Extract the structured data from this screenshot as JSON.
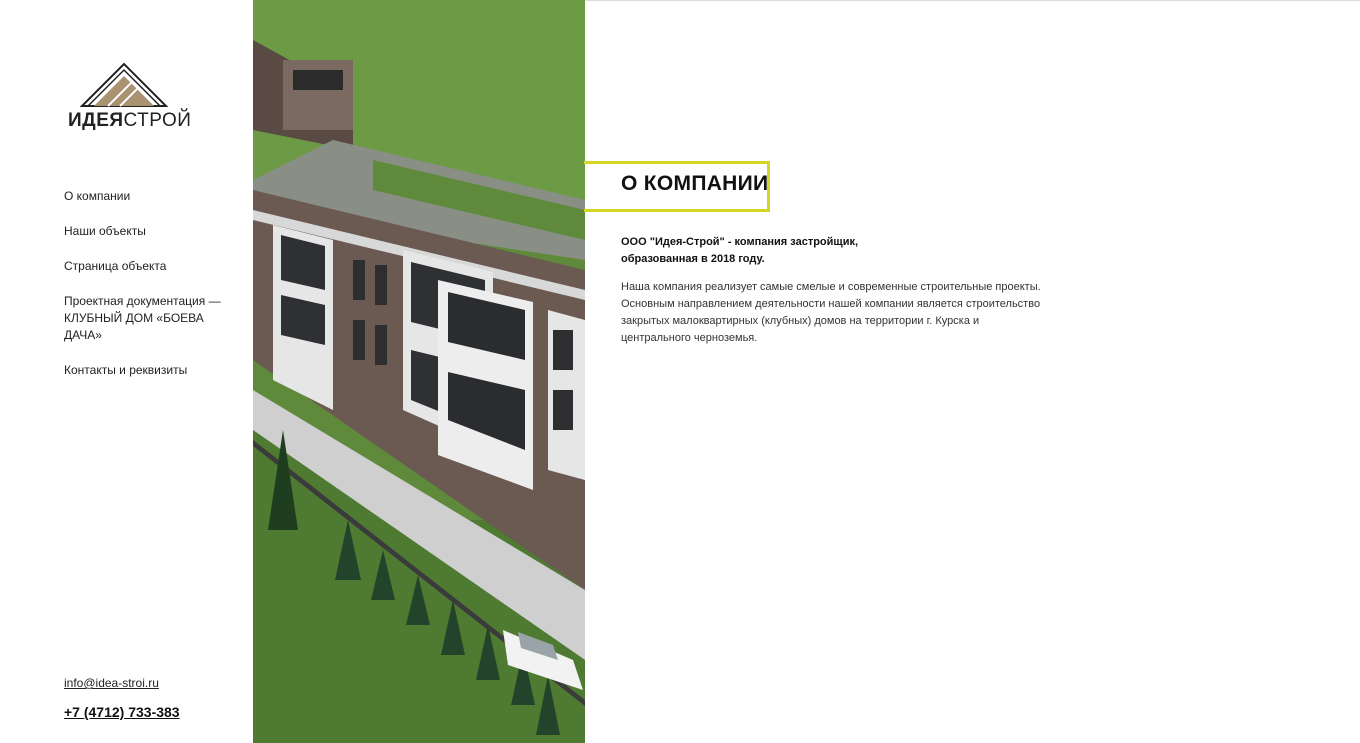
{
  "brand": {
    "name_bold": "ИДЕЯ",
    "name_regular": "СТРОЙ"
  },
  "nav": {
    "items": [
      {
        "label": "О компании"
      },
      {
        "label": "Наши объекты"
      },
      {
        "label": "Страница объекта"
      },
      {
        "label": "Проектная документация — КЛУБНЫЙ ДОМ «БОЕВА ДАЧА»"
      },
      {
        "label": "Контакты и реквизиты"
      }
    ]
  },
  "contacts": {
    "email": "info@idea-stroi.ru",
    "phone": "+7 (4712) 733-383"
  },
  "about": {
    "heading": "О КОМПАНИИ",
    "lead": "ООО \"Идея-Строй\" - компания застройщик, образованная в 2018 году.",
    "body": "Наша компания реализует самые смелые и современные строительные проекты. Основным направлением деятельности нашей компании является строительство закрытых малоквартирных (клубных) домов на территории г. Курска и центрального черноземья."
  },
  "colors": {
    "accent": "#d2d625",
    "text": "#1a1a1a",
    "background": "#ffffff"
  }
}
